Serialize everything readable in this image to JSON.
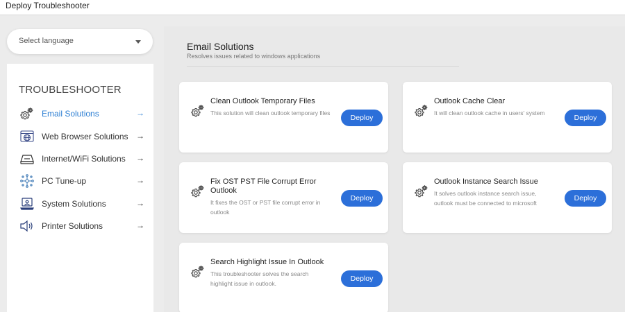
{
  "window": {
    "title": "Deploy Troubleshooter"
  },
  "language": {
    "placeholder": "Select language"
  },
  "sidebar": {
    "heading": "TROUBLESHOOTER",
    "active_color": "#2d7fd3",
    "items": [
      {
        "label": "Email Solutions",
        "icon": "gear-icon",
        "active": true
      },
      {
        "label": "Web Browser Solutions",
        "icon": "globe-icon",
        "active": false
      },
      {
        "label": "Internet/WiFi Solutions",
        "icon": "router-icon",
        "active": false
      },
      {
        "label": "PC Tune-up",
        "icon": "network-icon",
        "active": false
      },
      {
        "label": "System Solutions",
        "icon": "laptop-icon",
        "active": false
      },
      {
        "label": "Printer Solutions",
        "icon": "speaker-icon",
        "active": false
      }
    ],
    "arrow": "→"
  },
  "section": {
    "title": "Email Solutions",
    "subtitle": "Resolves issues related to windows applications"
  },
  "cards": [
    {
      "title": "Clean Outlook Temporary Files",
      "description": "This solution will clean outlook temporary files",
      "button": "Deploy"
    },
    {
      "title": "Outlook Cache Clear",
      "description": "It will clean outlook cache in users' system",
      "button": "Deploy"
    },
    {
      "title": "Fix OST PST File Corrupt Error Outlook",
      "description": "It fixes the OST or PST file corrupt error in outlook",
      "button": "Deploy"
    },
    {
      "title": "Outlook Instance Search Issue",
      "description": "It solves outlook instance search issue, outlook must be connected to microsoft",
      "button": "Deploy"
    },
    {
      "title": "Search Highlight Issue In Outlook",
      "description": "This troubleshooter solves the search highlight issue in outlook.",
      "button": "Deploy"
    }
  ],
  "colors": {
    "primary_button": "#2c6fd9",
    "active_nav": "#2d7fd3"
  }
}
